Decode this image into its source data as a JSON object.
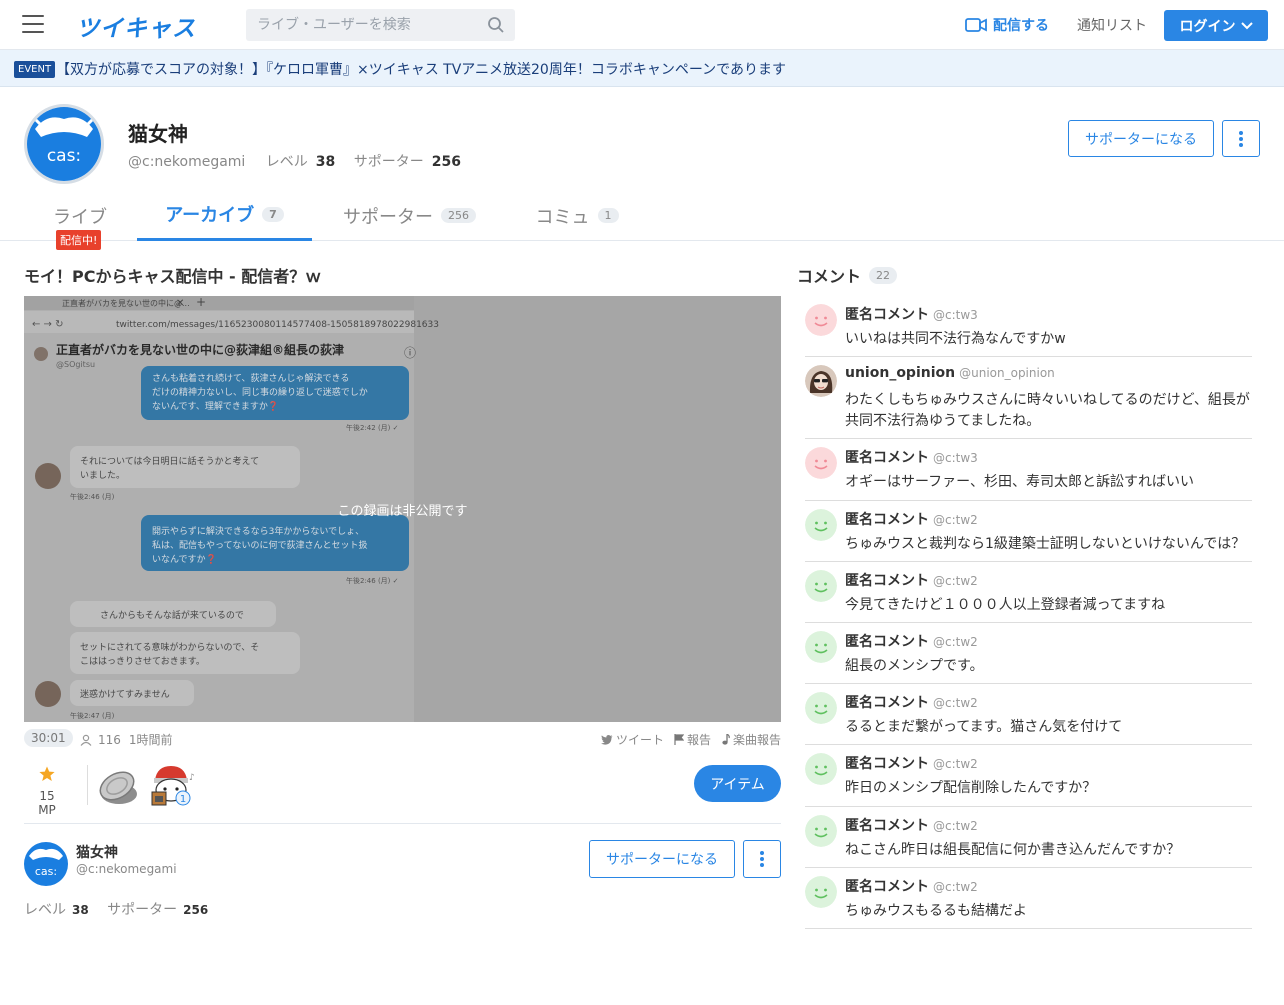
{
  "header": {
    "logo": "ツイキャス",
    "search_placeholder": "ライブ・ユーザーを検索",
    "broadcast": "配信する",
    "notify": "通知リスト",
    "login": "ログイン"
  },
  "event": {
    "badge": "EVENT",
    "text": "【双方が応募でスコアの対象！】『ケロロ軍曹』×ツイキャス TVアニメ放送20周年！コラボキャンペーンであります"
  },
  "profile": {
    "name": "猫女神",
    "id": "@c:nekomegami",
    "level_label": "レベル",
    "level": "38",
    "supporter_label": "サポーター",
    "supporters": "256",
    "avatar_text": "cas:",
    "support_button": "サポーターになる"
  },
  "tabs": [
    {
      "label": "ライブ",
      "count": ""
    },
    {
      "label": "アーカイブ",
      "count": "7"
    },
    {
      "label": "サポーター",
      "count": "256"
    },
    {
      "label": "コミュ",
      "count": "1"
    }
  ],
  "live_badge": "配信中!",
  "video": {
    "title": "モイ！PCからキャス配信中 - 配信者？ｗ",
    "private_text": "この録画は非公開です",
    "duration": "30:01",
    "views": "116",
    "time_ago": "1時間前",
    "tweet": "ツイート",
    "report": "報告",
    "music_report": "楽曲報告"
  },
  "screenshot": {
    "tab_title": "正直者がバカを見ない世の中に@...",
    "url": "twitter.com/messages/1165230080114577408-1505818978022981633",
    "dm_name": "正直者がバカを見ない世の中に@荻津組®組長の荻津",
    "dm_handle": "@SOgitsu",
    "msg1": "さんも粘着され続けて、荻津さんじゃ解決できるだけの精神力ないし、同じ事の繰り返しで迷惑でしかないんです、理解できますか❓",
    "time1": "午後2:42 (月) ✓",
    "msg2": "それについては今日明日に話そうかと考えていました。",
    "time2": "午後2:46 (月)",
    "msg3": "開示やらずに解決できるなら3年かからないでしょ、私は、配信もやってないのに何で荻津さんとセット扱いなんですか❓",
    "time3": "午後2:46 (月) ✓",
    "msg4": "さんからもそんな話が来ているので",
    "msg5": "セットにされてる意味がわからないので、そこははっきりさせておきます。",
    "msg6": "迷惑かけてすみません",
    "time4": "午後2:47 (月)"
  },
  "items": {
    "mp": "15 MP",
    "item_button": "アイテム",
    "badge_count": "1"
  },
  "comments_header": {
    "label": "コメント",
    "count": "22"
  },
  "comments": [
    {
      "name": "匿名コメント",
      "id": "@c:tw3",
      "text": "いいねは共同不法行為なんですかw",
      "avatar": "pink"
    },
    {
      "name": "union_opinion",
      "id": "@union_opinion",
      "text": "わたくしもちゅみウスさんに時々いいねしてるのだけど、組長が共同不法行為ゆうてましたね。",
      "avatar": "photo"
    },
    {
      "name": "匿名コメント",
      "id": "@c:tw3",
      "text": "オギーはサーファー、杉田、寿司太郎と訴訟すればいい",
      "avatar": "pink"
    },
    {
      "name": "匿名コメント",
      "id": "@c:tw2",
      "text": "ちゅみウスと裁判なら1級建築士証明しないといけないんでは？",
      "avatar": "green"
    },
    {
      "name": "匿名コメント",
      "id": "@c:tw2",
      "text": "今見てきたけど１０００人以上登録者減ってますね",
      "avatar": "green"
    },
    {
      "name": "匿名コメント",
      "id": "@c:tw2",
      "text": "組長のメンシプです。",
      "avatar": "green"
    },
    {
      "name": "匿名コメント",
      "id": "@c:tw2",
      "text": "るるとまだ繋がってます。猫さん気を付けて",
      "avatar": "green"
    },
    {
      "name": "匿名コメント",
      "id": "@c:tw2",
      "text": "昨日のメンシプ配信削除したんですか？",
      "avatar": "green"
    },
    {
      "name": "匿名コメント",
      "id": "@c:tw2",
      "text": "ねこさん昨日は組長配信に何か書き込んだんですか？",
      "avatar": "green"
    },
    {
      "name": "匿名コメント",
      "id": "@c:tw2",
      "text": "ちゅみウスもるるも結構だよ",
      "avatar": "green"
    }
  ],
  "colors": {
    "accent": "#2a86e4",
    "live": "#e8412c",
    "event_bg": "#eaf3fc"
  }
}
